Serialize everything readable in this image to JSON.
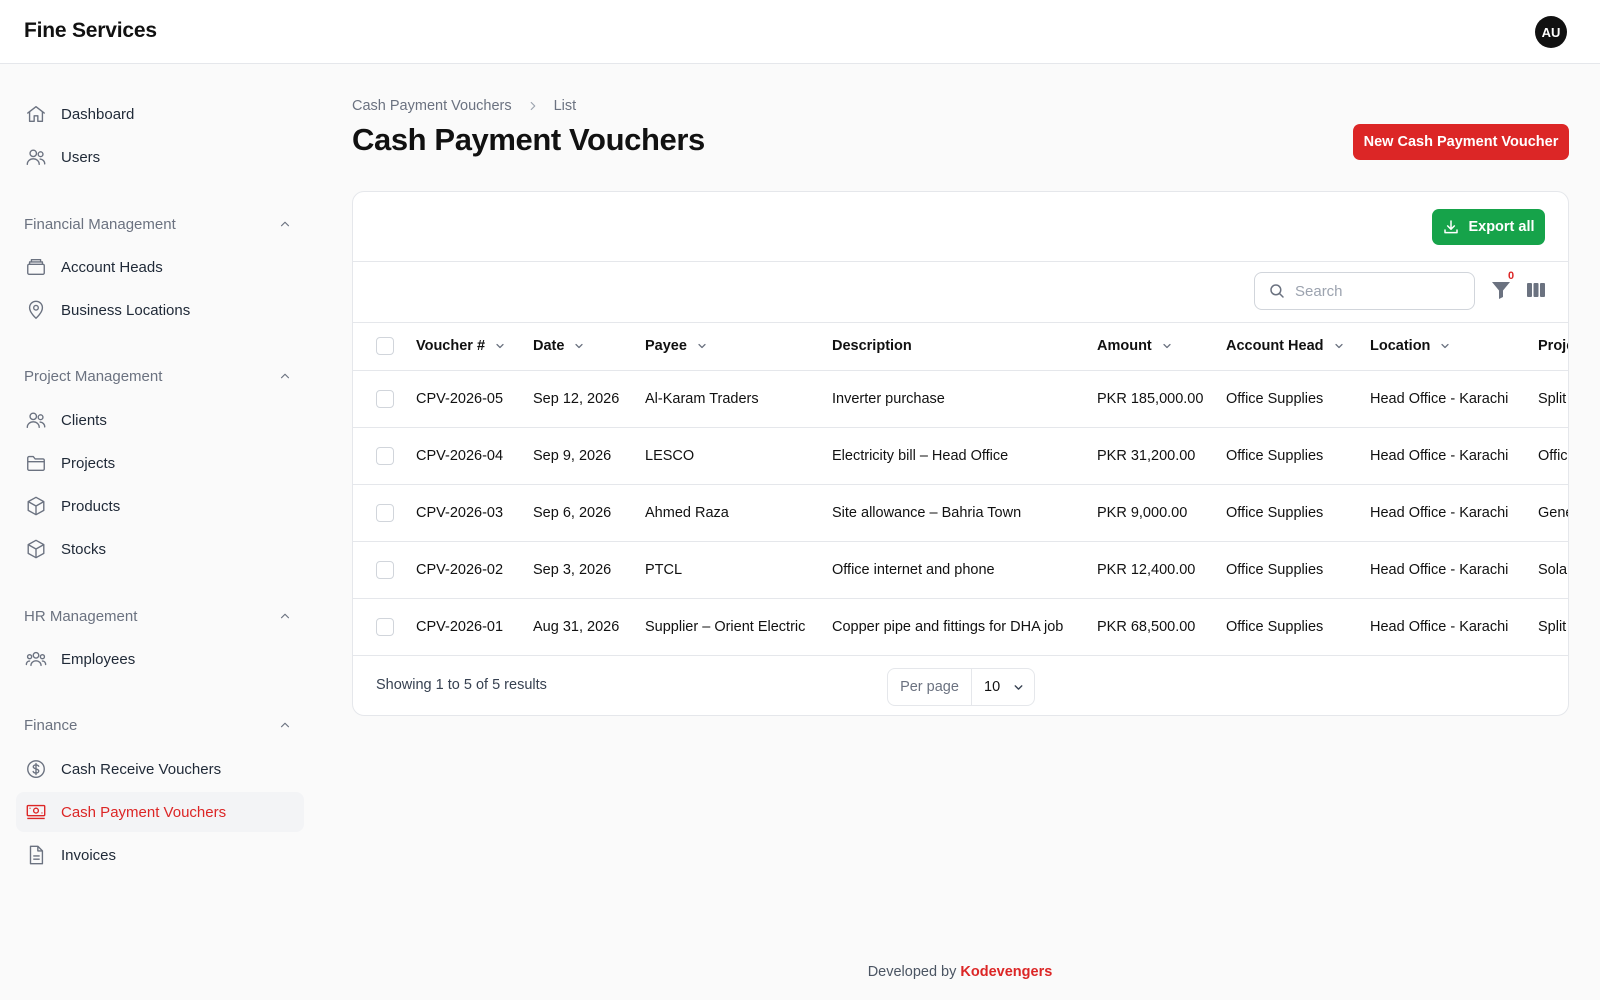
{
  "app": {
    "brand": "Fine Services",
    "user_initials": "AU"
  },
  "sidebar": {
    "top_items": [
      {
        "label": "Dashboard",
        "icon": "home-icon"
      },
      {
        "label": "Users",
        "icon": "users-icon"
      }
    ],
    "groups": [
      {
        "label": "Financial Management",
        "items": [
          {
            "label": "Account Heads",
            "icon": "archive-icon"
          },
          {
            "label": "Business Locations",
            "icon": "map-pin-icon"
          }
        ]
      },
      {
        "label": "Project Management",
        "items": [
          {
            "label": "Clients",
            "icon": "users-icon"
          },
          {
            "label": "Projects",
            "icon": "folder-icon"
          },
          {
            "label": "Products",
            "icon": "cube-icon"
          },
          {
            "label": "Stocks",
            "icon": "cube-icon"
          }
        ]
      },
      {
        "label": "HR Management",
        "items": [
          {
            "label": "Employees",
            "icon": "user-group-icon"
          }
        ]
      },
      {
        "label": "Finance",
        "items": [
          {
            "label": "Cash Receive Vouchers",
            "icon": "dollar-circle-icon"
          },
          {
            "label": "Cash Payment Vouchers",
            "icon": "banknotes-icon",
            "active": true
          },
          {
            "label": "Invoices",
            "icon": "document-icon"
          }
        ]
      }
    ]
  },
  "breadcrumb": {
    "parent": "Cash Payment Vouchers",
    "current": "List"
  },
  "page": {
    "title": "Cash Payment Vouchers",
    "new_button": "New Cash Payment Voucher"
  },
  "toolbar": {
    "export_label": "Export all",
    "search_placeholder": "Search",
    "filter_count": "0"
  },
  "table": {
    "columns": [
      "Voucher #",
      "Date",
      "Payee",
      "Description",
      "Amount",
      "Account Head",
      "Location",
      "Proje"
    ],
    "rows": [
      {
        "voucher": "CPV-2026-05",
        "date": "Sep 12, 2026",
        "payee": "Al-Karam Traders",
        "description": "Inverter purchase",
        "amount": "PKR 185,000.00",
        "account_head": "Office Supplies",
        "location": "Head Office - Karachi",
        "project": "Split"
      },
      {
        "voucher": "CPV-2026-04",
        "date": "Sep 9, 2026",
        "payee": "LESCO",
        "description": "Electricity bill – Head Office",
        "amount": "PKR 31,200.00",
        "account_head": "Office Supplies",
        "location": "Head Office - Karachi",
        "project": "Offic"
      },
      {
        "voucher": "CPV-2026-03",
        "date": "Sep 6, 2026",
        "payee": "Ahmed Raza",
        "description": "Site allowance – Bahria Town",
        "amount": "PKR 9,000.00",
        "account_head": "Office Supplies",
        "location": "Head Office - Karachi",
        "project": "Gene"
      },
      {
        "voucher": "CPV-2026-02",
        "date": "Sep 3, 2026",
        "payee": "PTCL",
        "description": "Office internet and phone",
        "amount": "PKR 12,400.00",
        "account_head": "Office Supplies",
        "location": "Head Office - Karachi",
        "project": "Solar"
      },
      {
        "voucher": "CPV-2026-01",
        "date": "Aug 31, 2026",
        "payee": "Supplier – Orient Electric",
        "description": "Copper pipe and fittings for DHA job",
        "amount": "PKR 68,500.00",
        "account_head": "Office Supplies",
        "location": "Head Office - Karachi",
        "project": "Split"
      }
    ]
  },
  "pagination": {
    "summary": "Showing 1 to 5 of 5 results",
    "per_page_label": "Per page",
    "per_page_value": "10"
  },
  "footer": {
    "prefix": "Developed by",
    "brand": "Kodevengers"
  }
}
